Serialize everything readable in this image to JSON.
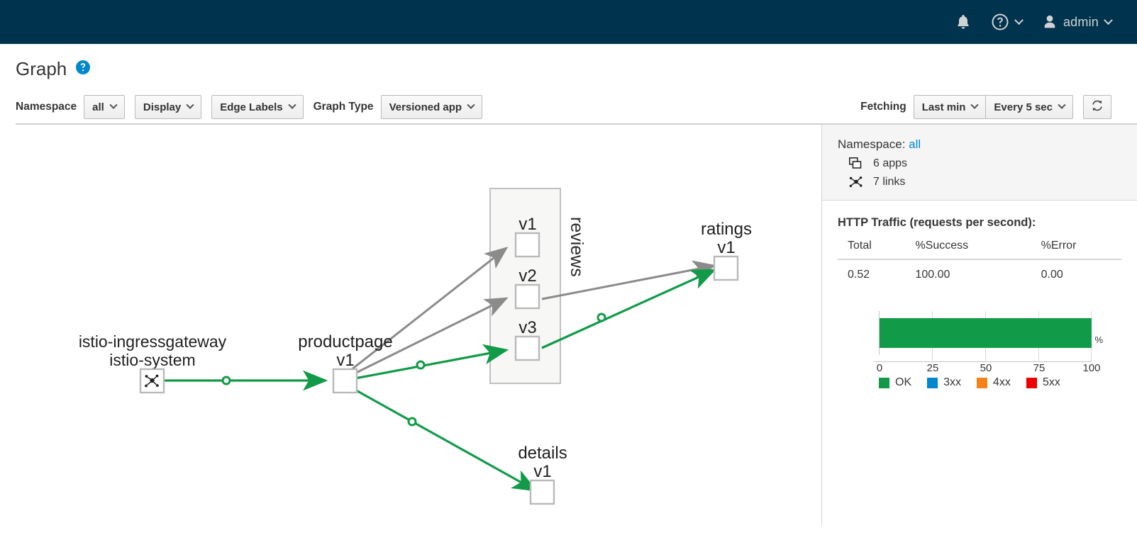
{
  "masthead": {
    "notifications_icon": "bell-icon",
    "help_icon": "help-circle-icon",
    "user_icon": "user-avatar-icon",
    "username": "admin"
  },
  "page": {
    "title": "Graph",
    "help_icon": "help-circle-icon"
  },
  "toolbar": {
    "namespace_label": "Namespace",
    "namespace_value": "all",
    "display_label": "Display",
    "edge_labels_label": "Edge Labels",
    "graph_type_label": "Graph Type",
    "graph_type_value": "Versioned app",
    "fetching_label": "Fetching",
    "duration_value": "Last min",
    "interval_value": "Every 5 sec",
    "refresh_icon": "refresh-icon"
  },
  "side": {
    "namespace_label": "Namespace:",
    "namespace_value": "all",
    "apps_icon": "apps-icon",
    "apps_text": "6 apps",
    "links_icon": "links-icon",
    "links_text": "7 links",
    "traffic_title": "HTTP Traffic (requests per second):",
    "columns": [
      "Total",
      "%Success",
      "%Error"
    ],
    "row": [
      "0.52",
      "100.00",
      "0.00"
    ]
  },
  "chart_data": {
    "type": "bar",
    "title": "HTTP Traffic (requests per second):",
    "orientation": "horizontal",
    "categories": [
      "requests"
    ],
    "series": [
      {
        "name": "OK",
        "values": [
          100
        ],
        "color": "#119b48"
      },
      {
        "name": "3xx",
        "values": [
          0
        ],
        "color": "#0088ce"
      },
      {
        "name": "4xx",
        "values": [
          0
        ],
        "color": "#f68218"
      },
      {
        "name": "5xx",
        "values": [
          0
        ],
        "color": "#ed0000"
      }
    ],
    "xlabel": "%",
    "xlim": [
      0,
      100
    ],
    "xticks": [
      0,
      25,
      50,
      75,
      100
    ],
    "grid": true,
    "legend_position": "bottom",
    "legend": [
      "OK",
      "3xx",
      "4xx",
      "5xx"
    ]
  },
  "graph": {
    "nodes": [
      {
        "id": "ingress",
        "title": "istio-ingressgateway",
        "subtitle": "istio-system",
        "icon": "gateway-icon"
      },
      {
        "id": "product",
        "title": "productpage",
        "subtitle": "v1"
      },
      {
        "id": "reviews1",
        "title": "v1"
      },
      {
        "id": "reviews2",
        "title": "v2"
      },
      {
        "id": "reviews3",
        "title": "v3"
      },
      {
        "id": "ratings",
        "title": "ratings",
        "subtitle": "v1"
      },
      {
        "id": "details",
        "title": "details",
        "subtitle": "v1"
      }
    ],
    "group_label": "reviews",
    "edge_colors": {
      "active": "#119b48",
      "idle": "#8b8b8b"
    }
  }
}
